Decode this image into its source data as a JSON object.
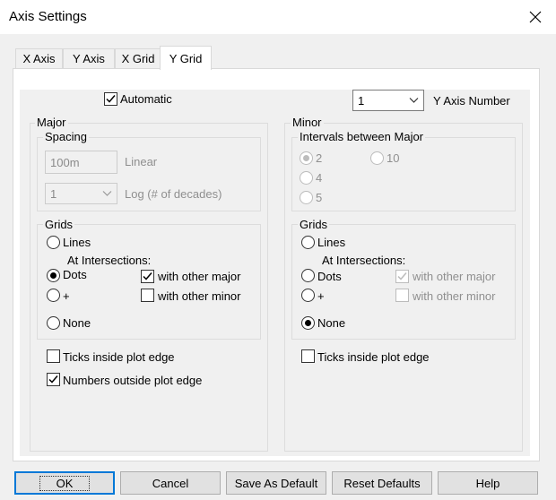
{
  "window": {
    "title": "Axis Settings"
  },
  "tabs": [
    {
      "label": "X Axis"
    },
    {
      "label": "Y Axis"
    },
    {
      "label": "X Grid"
    },
    {
      "label": "Y Grid",
      "active": true
    }
  ],
  "top": {
    "automatic_label": "Automatic",
    "automatic_checked": true,
    "axis_number_value": "1",
    "axis_number_label": "Y Axis Number"
  },
  "major": {
    "title": "Major",
    "spacing": {
      "title": "Spacing",
      "linear_value": "100m",
      "linear_label": "Linear",
      "log_value": "1",
      "log_label": "Log (# of decades)"
    },
    "grids": {
      "title": "Grids",
      "lines_label": "Lines",
      "at_intersections_label": "At Intersections:",
      "dots_label": "Dots",
      "plus_label": "+",
      "none_label": "None",
      "selected": "Dots",
      "with_other_major_label": "with other major",
      "with_other_major_checked": true,
      "with_other_minor_label": "with other minor",
      "with_other_minor_checked": false
    },
    "ticks_inside_label": "Ticks inside plot edge",
    "ticks_inside_checked": false,
    "numbers_outside_label": "Numbers outside plot edge",
    "numbers_outside_checked": true
  },
  "minor": {
    "title": "Minor",
    "intervals": {
      "title": "Intervals between Major",
      "options": [
        "2",
        "4",
        "5",
        "10"
      ],
      "selected": "2"
    },
    "grids": {
      "title": "Grids",
      "lines_label": "Lines",
      "at_intersections_label": "At Intersections:",
      "dots_label": "Dots",
      "plus_label": "+",
      "none_label": "None",
      "selected": "None",
      "with_other_major_label": "with other major",
      "with_other_major_checked": true,
      "with_other_minor_label": "with other minor",
      "with_other_minor_checked": false
    },
    "ticks_inside_label": "Ticks inside plot edge",
    "ticks_inside_checked": false
  },
  "buttons": {
    "ok": "OK",
    "cancel": "Cancel",
    "save_default": "Save As Default",
    "reset_defaults": "Reset Defaults",
    "help": "Help"
  },
  "icons": {
    "close": "close-icon",
    "check": "checkmark-icon",
    "dropdown": "chevron-down-icon"
  },
  "colors": {
    "accent": "#0078d7",
    "disabled_text": "#8f8f8f",
    "panel_bg": "#f0f0f0"
  }
}
